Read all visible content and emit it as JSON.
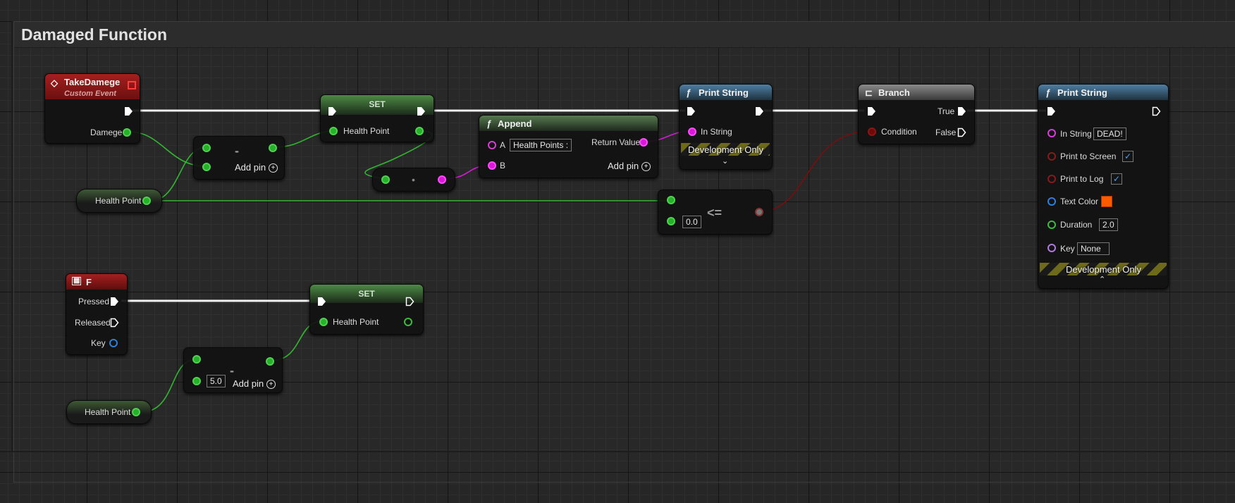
{
  "graph": {
    "comment_title": "Damaged Function",
    "colors": {
      "exec": "#ffffff",
      "float_pin": "#27b02a",
      "string_pin": "#d81ad8",
      "bool_pin": "#8f1414",
      "event_header": "#8c1a1a",
      "function_header": "#4b7aa0",
      "variable_header": "#3f6f3a",
      "text_color_value": "#ff5a00"
    }
  },
  "nodes": {
    "take_damage": {
      "title": "TakeDamege",
      "subtitle": "Custom Event",
      "out_label": "Damege",
      "icon": "event-diamond-icon"
    },
    "health_get_1": {
      "label": "Health Point"
    },
    "subtract_1": {
      "op": "-",
      "add_pin": "Add pin"
    },
    "set_1": {
      "title": "SET",
      "in_label": "Health Point"
    },
    "conv_1": {
      "op": "•"
    },
    "append": {
      "title": "Append",
      "a_label": "A",
      "a_value": "Health Points :",
      "b_label": "B",
      "return_label": "Return Value",
      "add_pin": "Add pin",
      "icon": "function-icon"
    },
    "print_string_1": {
      "title": "Print String",
      "in_label": "In String",
      "dev_only": "Development Only",
      "icon": "function-icon"
    },
    "compare": {
      "op": "<=",
      "value": "0.0"
    },
    "branch": {
      "title": "Branch",
      "condition": "Condition",
      "true_label": "True",
      "false_label": "False",
      "icon": "branch-icon"
    },
    "print_string_2": {
      "title": "Print String",
      "icon": "function-icon",
      "in_string_label": "In String",
      "in_string_value": "DEAD!",
      "print_screen_label": "Print to Screen",
      "print_screen_checked": "✓",
      "print_log_label": "Print to Log",
      "print_log_checked": "✓",
      "text_color_label": "Text Color",
      "duration_label": "Duration",
      "duration_value": "2.0",
      "key_label": "Key",
      "key_value": "None",
      "dev_only": "Development Only"
    },
    "key_f": {
      "title": "F",
      "pressed": "Pressed",
      "released": "Released",
      "key": "Key",
      "icon": "keyboard-icon"
    },
    "set_2": {
      "title": "SET",
      "in_label": "Health Point"
    },
    "subtract_2": {
      "op": "-",
      "value": "5.0",
      "add_pin": "Add pin"
    },
    "health_get_2": {
      "label": "Health Point"
    }
  }
}
